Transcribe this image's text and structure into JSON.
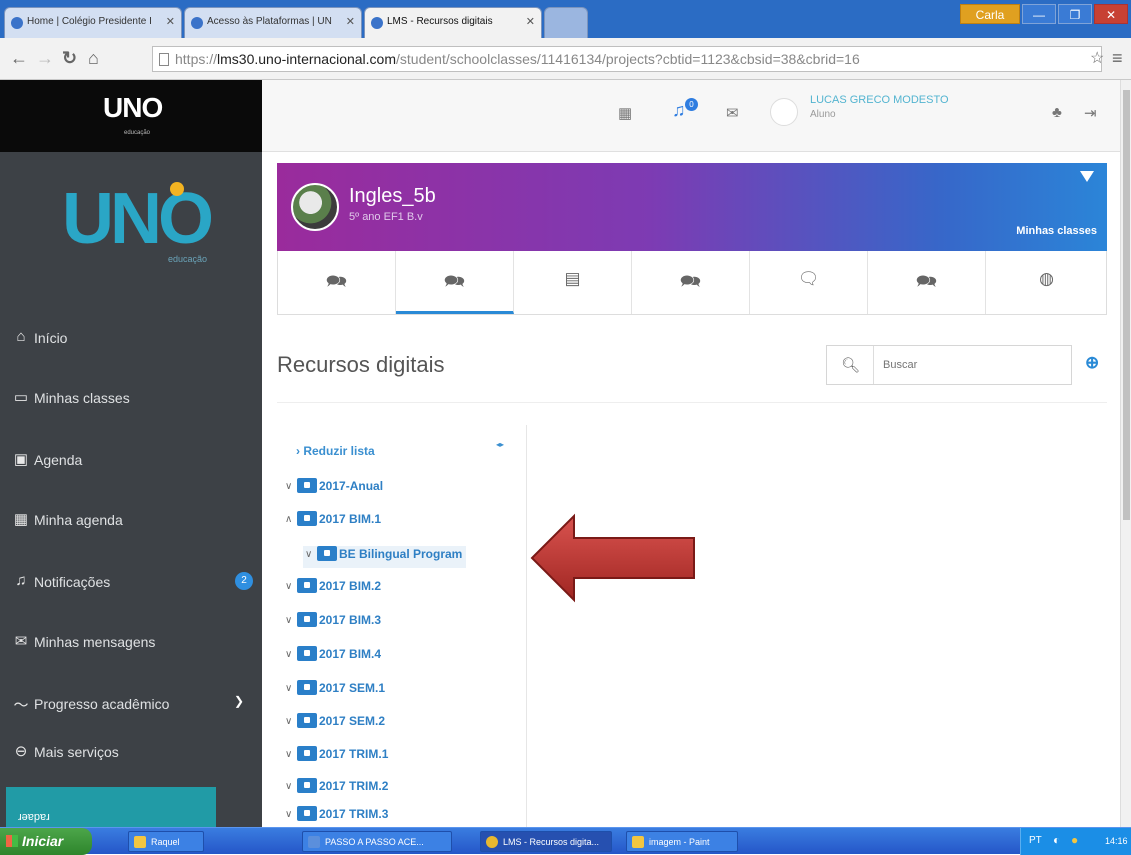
{
  "browser": {
    "tabs": [
      {
        "label": "Home | Colégio Presidente I",
        "active": false
      },
      {
        "label": "Acesso às Plataformas | UN",
        "active": false
      },
      {
        "label": "LMS - Recursos digitais",
        "active": true
      }
    ],
    "url_scheme": "https://",
    "url_host": "lms30.uno-internacional.com",
    "url_path": "/student/schoolclasses/11416134/projects?cbtid=1123&cbsid=38&cbrid=16",
    "window_user": "Carla"
  },
  "sidebar": {
    "logo_small": "UNO",
    "logo_small_sub": "educação",
    "logo_big": "UNO",
    "logo_big_sub": "educação",
    "items": [
      {
        "label": "Início",
        "icon": "home-icon"
      },
      {
        "label": "Minhas classes",
        "icon": "classes-icon"
      },
      {
        "label": "Agenda",
        "icon": "calendar-icon"
      },
      {
        "label": "Minha agenda",
        "icon": "agenda-grid-icon"
      },
      {
        "label": "Notificações",
        "icon": "bell-icon",
        "badge": "2"
      },
      {
        "label": "Minhas mensagens",
        "icon": "envelope-icon"
      },
      {
        "label": "Progresso acadêmico",
        "icon": "trend-icon"
      },
      {
        "label": "Mais serviços",
        "icon": "minus-circle-icon"
      }
    ],
    "banner_text": "ɹǝɐpɐɹ"
  },
  "header": {
    "notif_badge": "0",
    "user_name": "LUCAS GRECO MODESTO",
    "user_role": "Aluno"
  },
  "classcard": {
    "name": "Ingles_5b",
    "subtitle": "5º ano EF1 B.v",
    "my_classes_label": "Minhas classes"
  },
  "tool_tabs": [
    {
      "icon": "chat-home-icon",
      "active": false
    },
    {
      "icon": "chat-resources-icon",
      "active": true
    },
    {
      "icon": "document-icon",
      "active": false
    },
    {
      "icon": "chat-search-icon",
      "active": false
    },
    {
      "icon": "chat-reply-icon",
      "active": false
    },
    {
      "icon": "chat-board-icon",
      "active": false
    },
    {
      "icon": "globe-icon",
      "active": false
    }
  ],
  "main": {
    "title": "Recursos digitais",
    "search_placeholder": "Buscar",
    "reduzir_label": "Reduzir lista",
    "tree": [
      {
        "label": "2017-Anual",
        "expanded": false,
        "level": 0
      },
      {
        "label": "2017 BIM.1",
        "expanded": true,
        "level": 0
      },
      {
        "label": "BE Bilingual Program",
        "expanded": false,
        "level": 1,
        "selected": true
      },
      {
        "label": "2017 BIM.2",
        "expanded": false,
        "level": 0
      },
      {
        "label": "2017 BIM.3",
        "expanded": false,
        "level": 0
      },
      {
        "label": "2017 BIM.4",
        "expanded": false,
        "level": 0
      },
      {
        "label": "2017 SEM.1",
        "expanded": false,
        "level": 0
      },
      {
        "label": "2017 SEM.2",
        "expanded": false,
        "level": 0
      },
      {
        "label": "2017 TRIM.1",
        "expanded": false,
        "level": 0
      },
      {
        "label": "2017 TRIM.2",
        "expanded": false,
        "level": 0
      },
      {
        "label": "2017 TRIM.3",
        "expanded": false,
        "level": 0
      }
    ]
  },
  "taskbar": {
    "start_label": "Iniciar",
    "buttons": [
      {
        "label": "Raquel"
      },
      {
        "label": "PASSO A PASSO ACE..."
      },
      {
        "label": "LMS - Recursos digita..."
      },
      {
        "label": "imagem - Paint"
      }
    ],
    "lang": "PT",
    "time": "14:16"
  },
  "colors": {
    "accent": "#2a8ad6",
    "sidebar_bg": "#3d4146",
    "arrow_red": "#c0392b"
  }
}
